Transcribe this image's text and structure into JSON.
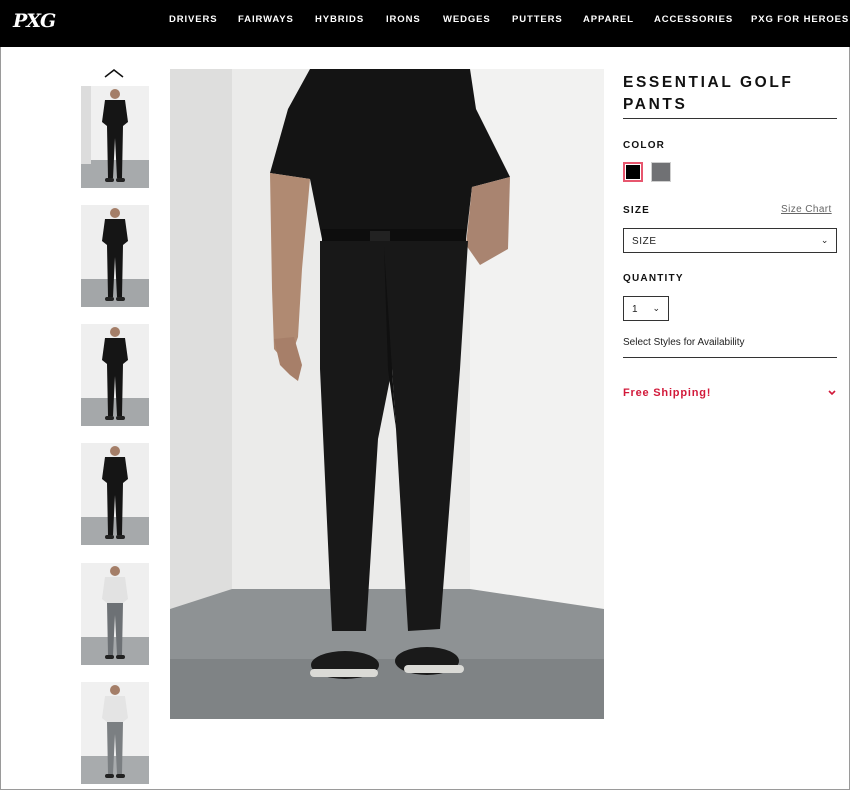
{
  "brand": {
    "logo_text": "PXG"
  },
  "nav": {
    "items": [
      "DRIVERS",
      "FAIRWAYS",
      "HYBRIDS",
      "IRONS",
      "WEDGES",
      "PUTTERS",
      "APPAREL",
      "ACCESSORIES",
      "PXG FOR HEROES"
    ]
  },
  "gallery": {
    "thumbnails": [
      {
        "shirt": "#151515",
        "pants": "#151515"
      },
      {
        "shirt": "#151515",
        "pants": "#151515"
      },
      {
        "shirt": "#151515",
        "pants": "#151515"
      },
      {
        "shirt": "#151515",
        "pants": "#151515"
      },
      {
        "shirt": "#e2e2e2",
        "pants": "#6d7175"
      },
      {
        "shirt": "#e4e4e4",
        "pants": "#7b7f82"
      }
    ]
  },
  "product": {
    "title": "ESSENTIAL GOLF PANTS",
    "color_label": "COLOR",
    "colors": [
      {
        "name": "black",
        "hex": "#000000",
        "selected": true
      },
      {
        "name": "gray",
        "hex": "#707174",
        "selected": false
      }
    ],
    "size_label": "SIZE",
    "size_chart_link": "Size Chart",
    "size_select_value": "SIZE",
    "quantity_label": "QUANTITY",
    "quantity_value": "1",
    "availability_text": "Select Styles for Availability",
    "shipping_text": "Free Shipping!",
    "accent_color": "#d2193a"
  }
}
